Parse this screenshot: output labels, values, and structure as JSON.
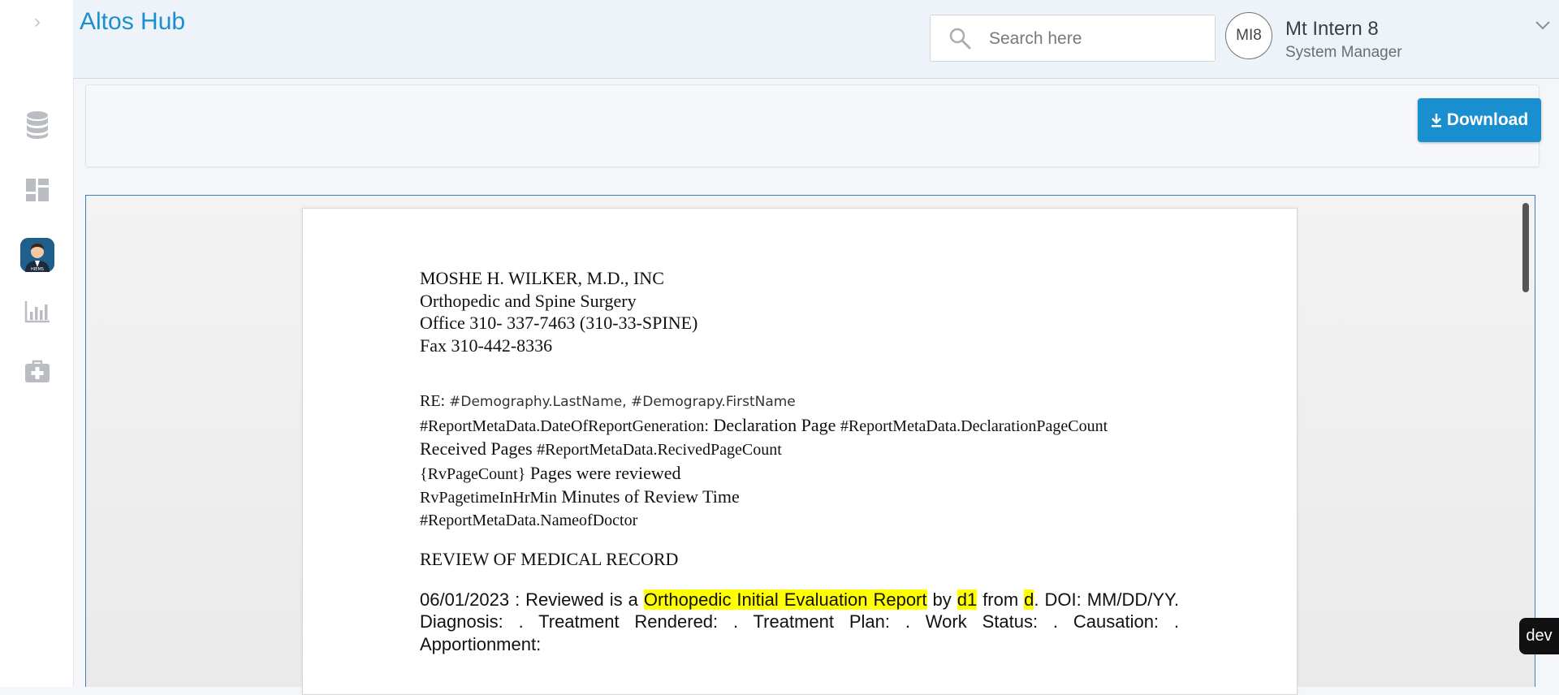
{
  "app": {
    "title": "Altos Hub"
  },
  "sidebar": {
    "items": [
      {
        "icon": "database-icon"
      },
      {
        "icon": "dashboard-icon"
      },
      {
        "icon": "user-avatar-icon",
        "badge": "HIEMS",
        "active": true
      },
      {
        "icon": "bar-chart-icon"
      },
      {
        "icon": "medical-kit-icon"
      }
    ]
  },
  "search": {
    "placeholder": "Search here"
  },
  "user": {
    "initials": "MI8",
    "name": "Mt Intern 8",
    "role": "System Manager"
  },
  "toolbar": {
    "download_label": "Download"
  },
  "document": {
    "header_lines": [
      "MOSHE H. WILKER, M.D., INC",
      "Orthopedic and Spine Surgery",
      "Office 310- 337-7463 (310-33-SPINE)",
      "Fax 310-442-8336"
    ],
    "re_label": "RE:",
    "re_fields": "#Demography.LastName, #Demograpy.FirstName",
    "report_date_field": "#ReportMetaData.DateOfReportGeneration:",
    "declaration_label": "Declaration Page",
    "declaration_field": "#ReportMetaData.DeclarationPageCount",
    "received_label": "Received Pages",
    "received_field": "#ReportMetaData.RecivedPageCount",
    "rv_count_field": "{RvPageCount}",
    "rv_count_text": "Pages were reviewed",
    "rv_time_field": "RvPagetimeInHrMin",
    "rv_time_text": "Minutes of Review Time",
    "doctor_field": "#ReportMetaData.NameofDoctor",
    "section_title": "REVIEW OF MEDICAL RECORD",
    "entry": {
      "date_prefix": "06/01/2023 :  Reviewed is a",
      "report_type": "Orthopedic Initial Evaluation Report",
      "by_word": "by",
      "author": "d1",
      "from_word": "from",
      "source": "d",
      "rest": ".  DOI: MM/DD/YY.  Diagnosis:  .  Treatment Rendered:  .  Treatment Plan:  .  Work Status:  .  Causation:  .  Apportionment:"
    }
  },
  "env_badge": "dev",
  "colors": {
    "accent": "#1a8fd0",
    "brand": "#1b8fcf",
    "highlight": "#ffff00",
    "viewer_border": "#3f7fbf"
  }
}
